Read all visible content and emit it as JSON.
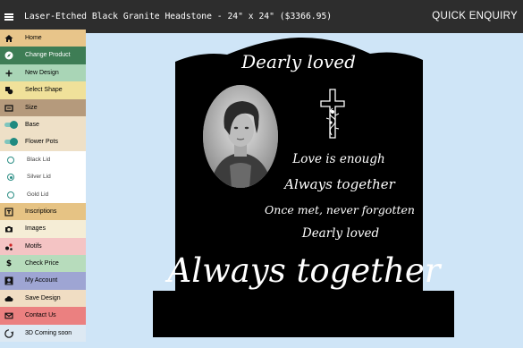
{
  "header": {
    "title": "Laser-Etched Black Granite Headstone - 24\" x 24\" ($3366.95)",
    "quick_enquiry": "QUICK ENQUIRY"
  },
  "sidebar": {
    "items": [
      {
        "label": "Home",
        "icon": "home-icon",
        "color": "#e8c58a"
      },
      {
        "label": "Change Product",
        "icon": "compass-icon",
        "color": "#3e7d55"
      },
      {
        "label": "New Design",
        "icon": "plus-icon",
        "color": "#a9d5b6"
      },
      {
        "label": "Select Shape",
        "icon": "shape-icon",
        "color": "#f0e19a"
      },
      {
        "label": "Size",
        "icon": "size-icon",
        "color": "#b59a7c"
      },
      {
        "label": "Base",
        "icon": "toggle-on",
        "color": "#eee0c7"
      },
      {
        "label": "Flower Pots",
        "icon": "toggle-on",
        "color": "#eee0c7"
      },
      {
        "label": "Black Lid",
        "icon": "radio-off",
        "color": "#ffffff"
      },
      {
        "label": "Silver Lid",
        "icon": "radio-on",
        "color": "#ffffff"
      },
      {
        "label": "Gold Lid",
        "icon": "radio-off",
        "color": "#ffffff"
      },
      {
        "label": "Inscriptions",
        "icon": "inscription-icon",
        "color": "#e6c384"
      },
      {
        "label": "Images",
        "icon": "camera-icon",
        "color": "#f5edd6"
      },
      {
        "label": "Motifs",
        "icon": "motif-icon",
        "color": "#f4c4c4"
      },
      {
        "label": "Check Price",
        "icon": "dollar-icon",
        "color": "#b7dcbc"
      },
      {
        "label": "My Account",
        "icon": "account-icon",
        "color": "#9ea5d3"
      },
      {
        "label": "Save Design",
        "icon": "cloud-icon",
        "color": "#f0ddc3"
      },
      {
        "label": "Contact Us",
        "icon": "mail-icon",
        "color": "#eb8080"
      },
      {
        "label": "3D Coming soon",
        "icon": "3d-icon",
        "color": "#dde9f3"
      }
    ]
  },
  "headstone": {
    "line1": "Dearly loved",
    "line2": "Love is enough",
    "line3": "Always together",
    "line4": "Once met, never forgotten",
    "line5": "Dearly loved",
    "line6": "Always together",
    "stone_color": "#000000",
    "background_color": "#cfe5f7"
  }
}
